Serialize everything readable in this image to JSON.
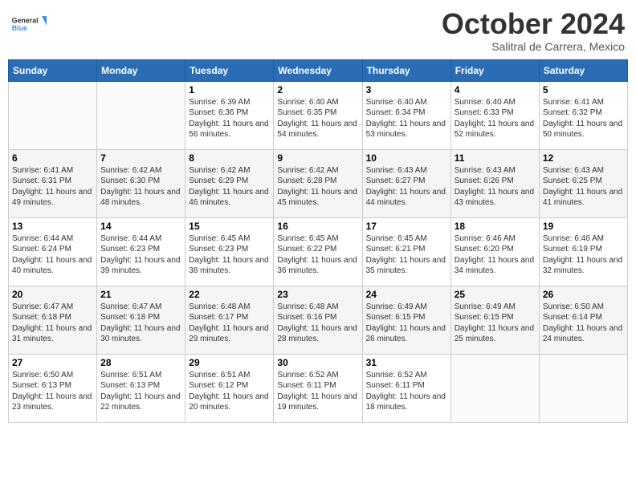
{
  "header": {
    "logo_line1": "General",
    "logo_line2": "Blue",
    "month": "October 2024",
    "location": "Salitral de Carrera, Mexico"
  },
  "weekdays": [
    "Sunday",
    "Monday",
    "Tuesday",
    "Wednesday",
    "Thursday",
    "Friday",
    "Saturday"
  ],
  "weeks": [
    [
      {
        "day": "",
        "info": ""
      },
      {
        "day": "",
        "info": ""
      },
      {
        "day": "1",
        "info": "Sunrise: 6:39 AM\nSunset: 6:36 PM\nDaylight: 11 hours and 56 minutes."
      },
      {
        "day": "2",
        "info": "Sunrise: 6:40 AM\nSunset: 6:35 PM\nDaylight: 11 hours and 54 minutes."
      },
      {
        "day": "3",
        "info": "Sunrise: 6:40 AM\nSunset: 6:34 PM\nDaylight: 11 hours and 53 minutes."
      },
      {
        "day": "4",
        "info": "Sunrise: 6:40 AM\nSunset: 6:33 PM\nDaylight: 11 hours and 52 minutes."
      },
      {
        "day": "5",
        "info": "Sunrise: 6:41 AM\nSunset: 6:32 PM\nDaylight: 11 hours and 50 minutes."
      }
    ],
    [
      {
        "day": "6",
        "info": "Sunrise: 6:41 AM\nSunset: 6:31 PM\nDaylight: 11 hours and 49 minutes."
      },
      {
        "day": "7",
        "info": "Sunrise: 6:42 AM\nSunset: 6:30 PM\nDaylight: 11 hours and 48 minutes."
      },
      {
        "day": "8",
        "info": "Sunrise: 6:42 AM\nSunset: 6:29 PM\nDaylight: 11 hours and 46 minutes."
      },
      {
        "day": "9",
        "info": "Sunrise: 6:42 AM\nSunset: 6:28 PM\nDaylight: 11 hours and 45 minutes."
      },
      {
        "day": "10",
        "info": "Sunrise: 6:43 AM\nSunset: 6:27 PM\nDaylight: 11 hours and 44 minutes."
      },
      {
        "day": "11",
        "info": "Sunrise: 6:43 AM\nSunset: 6:26 PM\nDaylight: 11 hours and 43 minutes."
      },
      {
        "day": "12",
        "info": "Sunrise: 6:43 AM\nSunset: 6:25 PM\nDaylight: 11 hours and 41 minutes."
      }
    ],
    [
      {
        "day": "13",
        "info": "Sunrise: 6:44 AM\nSunset: 6:24 PM\nDaylight: 11 hours and 40 minutes."
      },
      {
        "day": "14",
        "info": "Sunrise: 6:44 AM\nSunset: 6:23 PM\nDaylight: 11 hours and 39 minutes."
      },
      {
        "day": "15",
        "info": "Sunrise: 6:45 AM\nSunset: 6:23 PM\nDaylight: 11 hours and 38 minutes."
      },
      {
        "day": "16",
        "info": "Sunrise: 6:45 AM\nSunset: 6:22 PM\nDaylight: 11 hours and 36 minutes."
      },
      {
        "day": "17",
        "info": "Sunrise: 6:45 AM\nSunset: 6:21 PM\nDaylight: 11 hours and 35 minutes."
      },
      {
        "day": "18",
        "info": "Sunrise: 6:46 AM\nSunset: 6:20 PM\nDaylight: 11 hours and 34 minutes."
      },
      {
        "day": "19",
        "info": "Sunrise: 6:46 AM\nSunset: 6:19 PM\nDaylight: 11 hours and 32 minutes."
      }
    ],
    [
      {
        "day": "20",
        "info": "Sunrise: 6:47 AM\nSunset: 6:18 PM\nDaylight: 11 hours and 31 minutes."
      },
      {
        "day": "21",
        "info": "Sunrise: 6:47 AM\nSunset: 6:18 PM\nDaylight: 11 hours and 30 minutes."
      },
      {
        "day": "22",
        "info": "Sunrise: 6:48 AM\nSunset: 6:17 PM\nDaylight: 11 hours and 29 minutes."
      },
      {
        "day": "23",
        "info": "Sunrise: 6:48 AM\nSunset: 6:16 PM\nDaylight: 11 hours and 28 minutes."
      },
      {
        "day": "24",
        "info": "Sunrise: 6:49 AM\nSunset: 6:15 PM\nDaylight: 11 hours and 26 minutes."
      },
      {
        "day": "25",
        "info": "Sunrise: 6:49 AM\nSunset: 6:15 PM\nDaylight: 11 hours and 25 minutes."
      },
      {
        "day": "26",
        "info": "Sunrise: 6:50 AM\nSunset: 6:14 PM\nDaylight: 11 hours and 24 minutes."
      }
    ],
    [
      {
        "day": "27",
        "info": "Sunrise: 6:50 AM\nSunset: 6:13 PM\nDaylight: 11 hours and 23 minutes."
      },
      {
        "day": "28",
        "info": "Sunrise: 6:51 AM\nSunset: 6:13 PM\nDaylight: 11 hours and 22 minutes."
      },
      {
        "day": "29",
        "info": "Sunrise: 6:51 AM\nSunset: 6:12 PM\nDaylight: 11 hours and 20 minutes."
      },
      {
        "day": "30",
        "info": "Sunrise: 6:52 AM\nSunset: 6:11 PM\nDaylight: 11 hours and 19 minutes."
      },
      {
        "day": "31",
        "info": "Sunrise: 6:52 AM\nSunset: 6:11 PM\nDaylight: 11 hours and 18 minutes."
      },
      {
        "day": "",
        "info": ""
      },
      {
        "day": "",
        "info": ""
      }
    ]
  ]
}
